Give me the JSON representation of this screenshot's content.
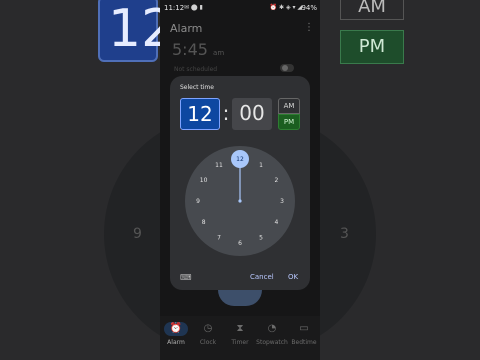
{
  "status_bar": {
    "time": "11:12",
    "left_icons": "✉ ⬤ ▮",
    "right_icons": "⏰ ✱ ◈ ▾ ◢",
    "battery": "94%"
  },
  "app": {
    "title": "Alarm",
    "more_icon": "⋮",
    "background_time": "5:45",
    "background_time_suffix": "am",
    "background_row": "Not scheduled"
  },
  "dialog": {
    "heading": "Select time",
    "hour": "12",
    "separator": ":",
    "minute": "00",
    "am_label": "AM",
    "pm_label": "PM",
    "selected_period": "PM",
    "dial_numbers": [
      "12",
      "1",
      "2",
      "3",
      "4",
      "5",
      "6",
      "7",
      "8",
      "9",
      "10",
      "11"
    ],
    "selected_hour_index": 0,
    "keyboard_icon": "⌨",
    "cancel_label": "Cancel",
    "ok_label": "OK"
  },
  "bottom_nav": [
    {
      "label": "Alarm",
      "icon": "⏰",
      "active": true
    },
    {
      "label": "Clock",
      "icon": "◷",
      "active": false
    },
    {
      "label": "Timer",
      "icon": "⧗",
      "active": false
    },
    {
      "label": "Stopwatch",
      "icon": "◔",
      "active": false
    },
    {
      "label": "Bedtime",
      "icon": "▭",
      "active": false
    }
  ],
  "side_copies": {
    "hour": "12",
    "am_label": "AM",
    "pm_label": "PM",
    "left_number": "9",
    "right_number": "3"
  },
  "colors": {
    "selected_hour_bg": "#0d47a1",
    "pm_selected_bg": "#1b5e20",
    "dial_face": "#474a4f",
    "dial_handle": "#a8c7fa",
    "dialog_bg": "#2f3033"
  }
}
